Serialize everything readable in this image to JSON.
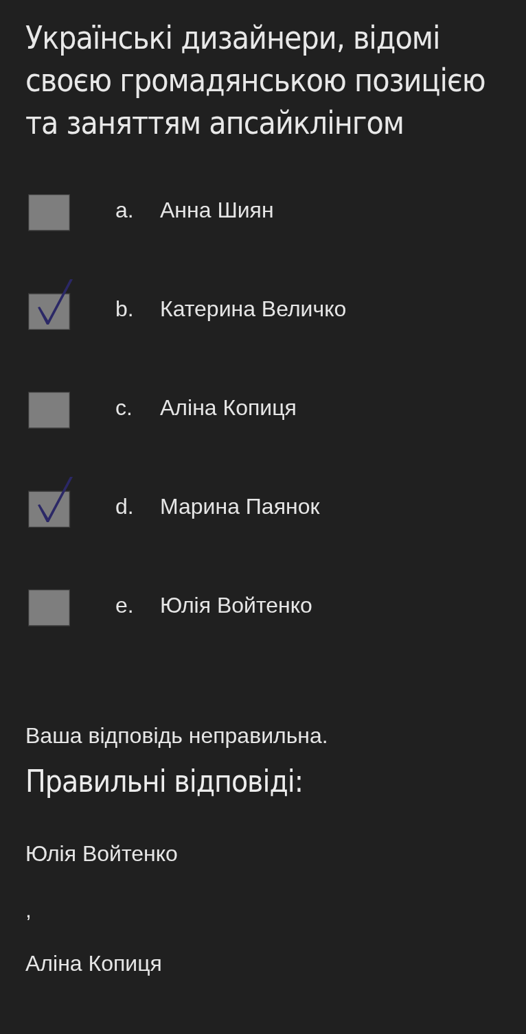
{
  "question": {
    "text": "Українські дизайнери, відомі своєю громадянською позицією та заняттям апсайклінгом"
  },
  "options": [
    {
      "letter": "a.",
      "label": "Анна Шиян",
      "checked": false
    },
    {
      "letter": "b.",
      "label": "Катерина Величко",
      "checked": true
    },
    {
      "letter": "c.",
      "label": "Аліна Копиця",
      "checked": false
    },
    {
      "letter": "d.",
      "label": "Марина Паянок",
      "checked": true
    },
    {
      "letter": "e.",
      "label": "Юлія Войтенко",
      "checked": false
    }
  ],
  "feedback": {
    "verdict": "Ваша відповідь неправильна.",
    "heading": "Правильні відповіді:",
    "answers": [
      "Юлія Войтенко",
      "Аліна Копиця"
    ],
    "separator": ","
  }
}
